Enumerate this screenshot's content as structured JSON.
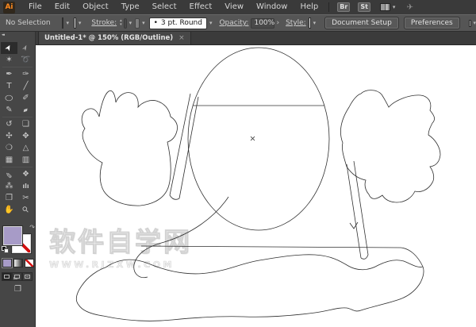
{
  "app": {
    "name": "Adobe Illustrator",
    "logo": "Ai"
  },
  "icons": {
    "chevron_down": "▾",
    "chevron_right": "›",
    "stepper_up": "▴",
    "stepper_down": "▾",
    "close": "×",
    "collapse": "◂◂",
    "swap_arrow": "↷",
    "screen_mode": "❐",
    "cs_live": "✈",
    "brush_dot": "•",
    "menu_divider": ""
  },
  "menu_bar": {
    "items": [
      "File",
      "Edit",
      "Object",
      "Type",
      "Select",
      "Effect",
      "View",
      "Window",
      "Help"
    ],
    "bridge_button": "Br",
    "style_button": "St"
  },
  "control_bar": {
    "selection_status": "No Selection",
    "stroke_label": "Stroke:",
    "brush_style": "3 pt. Round",
    "opacity_label": "Opacity:",
    "opacity_value": "100%",
    "style_label": "Style:",
    "document_setup_button": "Document Setup",
    "preferences_button": "Preferences",
    "fill_color": "#a79bc7",
    "stroke_color": "none"
  },
  "document_tab": {
    "title": "Untitled-1* @ 150% (RGB/Outline)"
  },
  "toolbar": {
    "fill_color": "#a79bc7",
    "tools": [
      {
        "name": "selection-tool",
        "glyph": "➤",
        "selected": true
      },
      {
        "name": "direct-selection-tool",
        "glyph": "➢"
      },
      {
        "name": "magic-wand-tool",
        "glyph": "✶"
      },
      {
        "name": "lasso-tool",
        "glyph": "➰"
      },
      {
        "name": "pen-tool",
        "glyph": "✒"
      },
      {
        "name": "blob-brush-tool",
        "glyph": "✑"
      },
      {
        "name": "type-tool",
        "glyph": "T"
      },
      {
        "name": "line-segment-tool",
        "glyph": "╱"
      },
      {
        "name": "ellipse-tool",
        "glyph": "○"
      },
      {
        "name": "paintbrush-tool",
        "glyph": "✐"
      },
      {
        "name": "pencil-tool",
        "glyph": "✎"
      },
      {
        "name": "eraser-tool",
        "glyph": "▰"
      },
      {
        "name": "rotate-tool",
        "glyph": "↺"
      },
      {
        "name": "scale-tool",
        "glyph": "❏"
      },
      {
        "name": "width-tool",
        "glyph": "✣"
      },
      {
        "name": "free-transform-tool",
        "glyph": "✥"
      },
      {
        "name": "shape-builder-tool",
        "glyph": "❍"
      },
      {
        "name": "perspective-grid-tool",
        "glyph": "△"
      },
      {
        "name": "mesh-tool",
        "glyph": "▦"
      },
      {
        "name": "gradient-tool",
        "glyph": "▥"
      },
      {
        "name": "eyedropper-tool",
        "glyph": "✎"
      },
      {
        "name": "blend-tool",
        "glyph": "❖"
      },
      {
        "name": "symbol-sprayer-tool",
        "glyph": "⁂"
      },
      {
        "name": "column-graph-tool",
        "glyph": "ılı"
      },
      {
        "name": "artboard-tool",
        "glyph": "❐"
      },
      {
        "name": "slice-tool",
        "glyph": "✂"
      },
      {
        "name": "hand-tool",
        "glyph": "✋"
      },
      {
        "name": "zoom-tool",
        "glyph": "⚲"
      }
    ]
  },
  "canvas": {
    "watermark_title": "软件自学网",
    "watermark_url": "WWW.RJZXW.COM"
  }
}
